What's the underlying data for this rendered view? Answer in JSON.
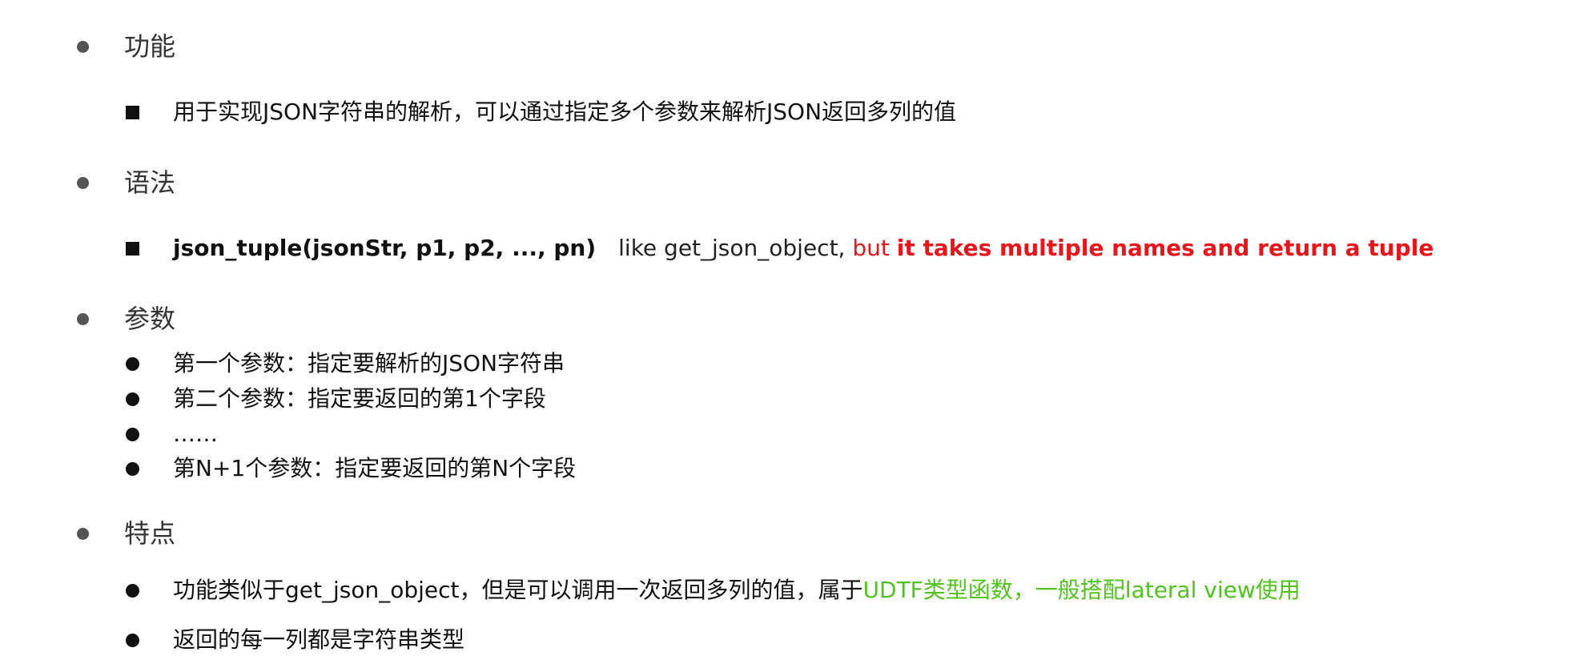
{
  "colors": {
    "text": "#111111",
    "heading": "#333333",
    "highlight_red": "#e8161b",
    "highlight_green": "#4fc41c"
  },
  "sections": {
    "function": {
      "title": "功能",
      "items": [
        {
          "text": "用于实现JSON字符串的解析，可以通过指定多个参数来解析JSON返回多列的值"
        }
      ]
    },
    "syntax": {
      "title": "语法",
      "signature": "json_tuple(jsonStr, p1, p2, ..., pn)",
      "desc_plain": "like get_json_object, ",
      "desc_red": "but ",
      "desc_red_bold": "it takes multiple names and return a tuple"
    },
    "params": {
      "title": "参数",
      "items": [
        "第一个参数：指定要解析的JSON字符串",
        "第二个参数：指定要返回的第1个字段",
        "……",
        "第N+1个参数：指定要返回的第N个字段"
      ]
    },
    "features": {
      "title": "特点",
      "item1_plain": "功能类似于get_json_object，但是可以调用一次返回多列的值，属于",
      "item1_green": "UDTF类型函数，一般搭配lateral view使用",
      "item2": "返回的每一列都是字符串类型"
    }
  }
}
